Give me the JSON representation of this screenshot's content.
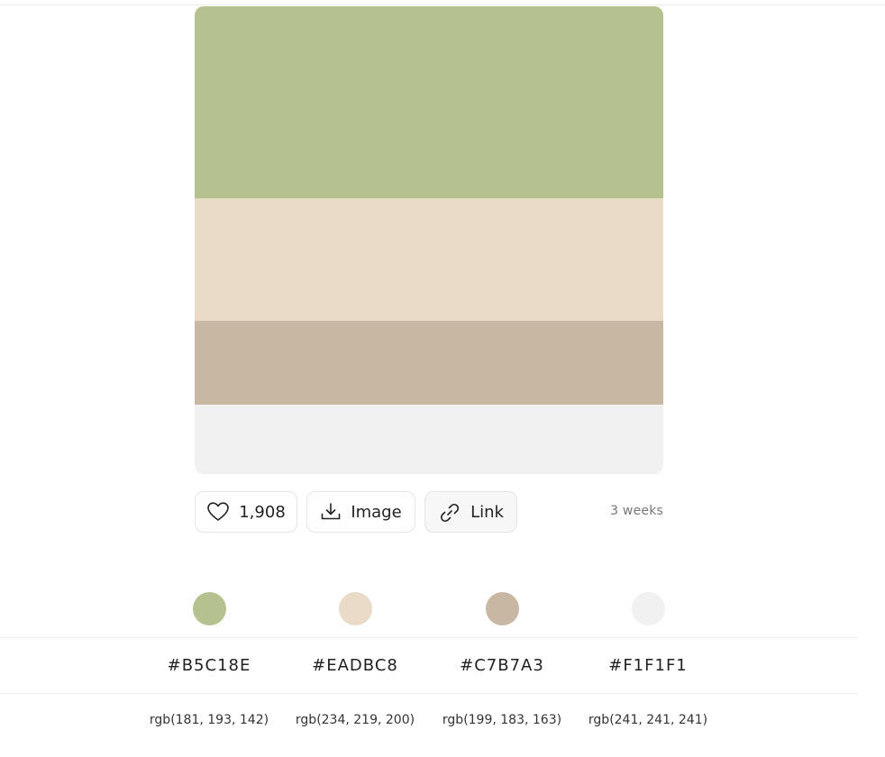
{
  "palette": {
    "colors": [
      {
        "hex": "#B5C18E",
        "rgb": "rgb(181, 193, 142)"
      },
      {
        "hex": "#EADBC8",
        "rgb": "rgb(234, 219, 200)"
      },
      {
        "hex": "#C7B7A3",
        "rgb": "rgb(199, 183, 163)"
      },
      {
        "hex": "#F1F1F1",
        "rgb": "rgb(241, 241, 241)"
      }
    ]
  },
  "actions": {
    "likes": "1,908",
    "like_icon": "heart-icon",
    "image_label": "Image",
    "image_icon": "download-icon",
    "link_label": "Link",
    "link_icon": "link-icon"
  },
  "meta": {
    "age": "3 weeks"
  }
}
